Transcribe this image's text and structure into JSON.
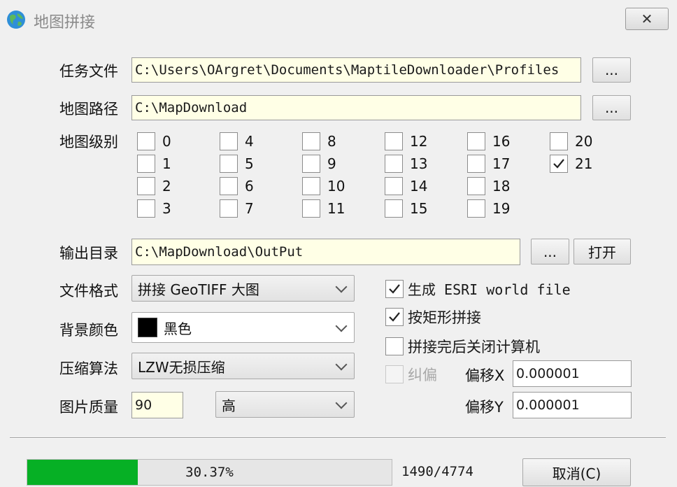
{
  "window": {
    "title": "地图拼接",
    "close_label": "✕"
  },
  "task_file": {
    "label": "任务文件",
    "value": "C:\\Users\\OArgret\\Documents\\MaptileDownloader\\Profiles",
    "browse_label": "..."
  },
  "map_path": {
    "label": "地图路径",
    "value": "C:\\MapDownload",
    "browse_label": "..."
  },
  "map_levels": {
    "label": "地图级别",
    "levels": [
      "0",
      "1",
      "2",
      "3",
      "4",
      "5",
      "6",
      "7",
      "8",
      "9",
      "10",
      "11",
      "12",
      "13",
      "14",
      "15",
      "16",
      "17",
      "18",
      "19",
      "20",
      "21"
    ],
    "checked": [
      false,
      false,
      false,
      false,
      false,
      false,
      false,
      false,
      false,
      false,
      false,
      false,
      false,
      false,
      false,
      false,
      false,
      false,
      false,
      false,
      false,
      true
    ]
  },
  "output_dir": {
    "label": "输出目录",
    "value": "C:\\MapDownload\\OutPut",
    "browse_label": "...",
    "open_label": "打开"
  },
  "file_format": {
    "label": "文件格式",
    "value": "拼接 GeoTIFF 大图"
  },
  "bg_color": {
    "label": "背景颜色",
    "value": "黑色",
    "swatch": "#000000"
  },
  "compression": {
    "label": "压缩算法",
    "value": "LZW无损压缩"
  },
  "quality": {
    "label": "图片质量",
    "value": "90",
    "level": "高"
  },
  "options": {
    "esri": {
      "label": "生成 ESRI world file",
      "checked": true
    },
    "rect": {
      "label": "按矩形拼接",
      "checked": true
    },
    "shutdown": {
      "label": "拼接完后关闭计算机",
      "checked": false
    },
    "correct": {
      "label": "纠偏",
      "checked": false,
      "enabled": false
    }
  },
  "offset": {
    "x_label": "偏移X",
    "x_value": "0.000001",
    "y_label": "偏移Y",
    "y_value": "0.000001"
  },
  "progress": {
    "percent_text": "30.37%",
    "fraction": 0.3037,
    "count": "1490/4774"
  },
  "cancel_label": "取消(C)",
  "colors": {
    "progress": "#06b025",
    "field_bg": "#ffffe6"
  }
}
